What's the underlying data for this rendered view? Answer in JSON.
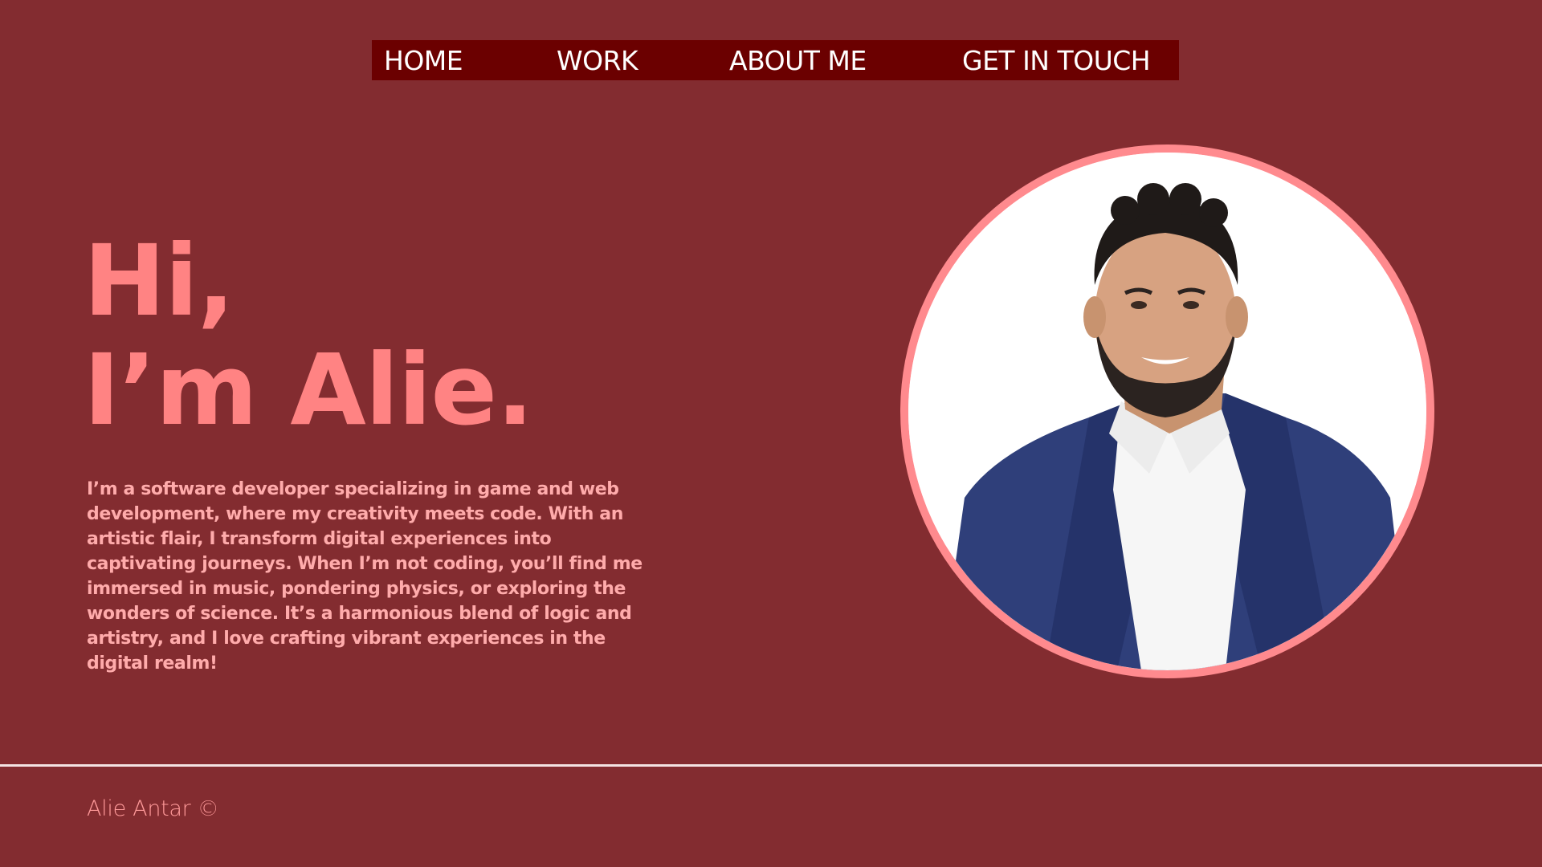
{
  "nav": {
    "items": [
      {
        "label": "HOME"
      },
      {
        "label": "WORK"
      },
      {
        "label": "ABOUT ME"
      },
      {
        "label": "GET IN TOUCH"
      }
    ]
  },
  "hero": {
    "greeting_line1": "Hi,",
    "greeting_line2": "I’m Alie.",
    "bio": "I’m a software developer specializing in game and web development, where my creativity meets code. With an artistic flair, I transform digital experiences into captivating journeys. When I’m not coding, you’ll find me immersed in music, pondering physics, or exploring the wonders of science. It’s a harmonious blend of logic and artistry, and I love crafting vibrant experiences in the digital realm!"
  },
  "portrait": {
    "icon": "profile-photo"
  },
  "footer": {
    "credit": "Alie Antar ©"
  },
  "colors": {
    "background": "#832c30",
    "nav_background": "#6b0000",
    "accent": "#ff8383",
    "portrait_ring": "#ff8a8e",
    "footer_rule": "#f4e3e3"
  }
}
